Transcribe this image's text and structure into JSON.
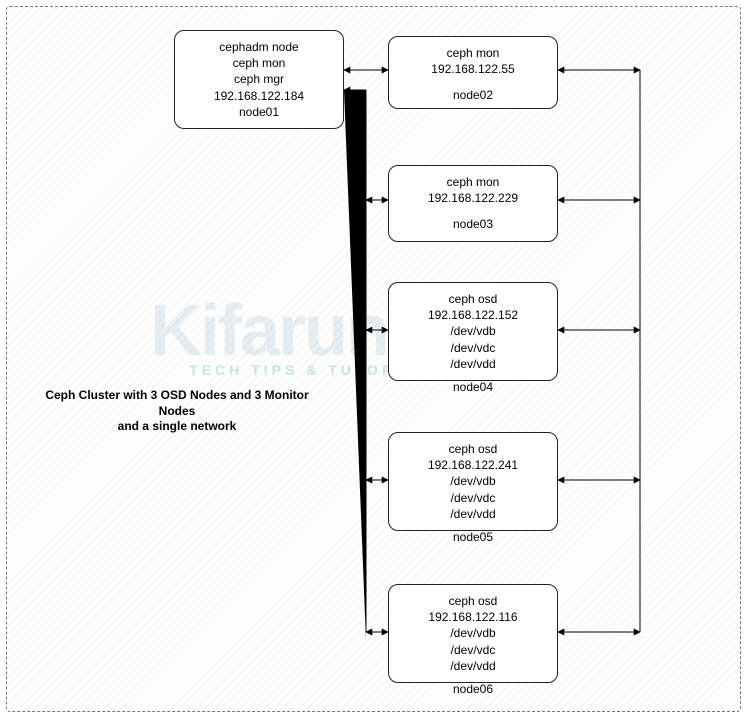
{
  "caption_line1": "Ceph Cluster with 3 OSD Nodes and 3 Monitor Nodes",
  "caption_line2": "and a single network",
  "watermark_main": "Kifarunix",
  "watermark_sub": "TECH TIPS & TUTORIALS",
  "nodes": {
    "node01": {
      "lines": [
        "cephadm node",
        "ceph mon",
        "ceph mgr",
        "192.168.122.184"
      ],
      "tag": "node01"
    },
    "node02": {
      "lines": [
        "ceph mon",
        "192.168.122.55"
      ],
      "tag": "node02"
    },
    "node03": {
      "lines": [
        "ceph mon",
        "192.168.122.229"
      ],
      "tag": "node03"
    },
    "node04": {
      "lines": [
        "ceph osd",
        "192.168.122.152",
        "/dev/vdb",
        "/dev/vdc",
        "/dev/vdd"
      ],
      "tag": "node04"
    },
    "node05": {
      "lines": [
        "ceph osd",
        "192.168.122.241",
        "/dev/vdb",
        "/dev/vdc",
        "/dev/vdd"
      ],
      "tag": "node05"
    },
    "node06": {
      "lines": [
        "ceph osd",
        "192.168.122.116",
        "/dev/vdb",
        "/dev/vdc",
        "/dev/vdd"
      ],
      "tag": "node06"
    }
  },
  "chart_data": {
    "type": "diagram",
    "title": "Ceph Cluster with 3 OSD Nodes and 3 Monitor Nodes and a single network",
    "nodes": [
      {
        "id": "node01",
        "roles": [
          "cephadm node",
          "ceph mon",
          "ceph mgr"
        ],
        "ip": "192.168.122.184"
      },
      {
        "id": "node02",
        "roles": [
          "ceph mon"
        ],
        "ip": "192.168.122.55"
      },
      {
        "id": "node03",
        "roles": [
          "ceph mon"
        ],
        "ip": "192.168.122.229"
      },
      {
        "id": "node04",
        "roles": [
          "ceph osd"
        ],
        "ip": "192.168.122.152",
        "devices": [
          "/dev/vdb",
          "/dev/vdc",
          "/dev/vdd"
        ]
      },
      {
        "id": "node05",
        "roles": [
          "ceph osd"
        ],
        "ip": "192.168.122.241",
        "devices": [
          "/dev/vdb",
          "/dev/vdc",
          "/dev/vdd"
        ]
      },
      {
        "id": "node06",
        "roles": [
          "ceph osd"
        ],
        "ip": "192.168.122.116",
        "devices": [
          "/dev/vdb",
          "/dev/vdc",
          "/dev/vdd"
        ]
      }
    ],
    "edges": [
      {
        "from": "node01",
        "to": "node02",
        "bidirectional": true
      },
      {
        "from": "node01",
        "to": "node03",
        "bidirectional": true
      },
      {
        "from": "node01",
        "to": "node04",
        "bidirectional": true
      },
      {
        "from": "node01",
        "to": "node05",
        "bidirectional": true
      },
      {
        "from": "node01",
        "to": "node06",
        "bidirectional": true
      },
      {
        "from": "node02",
        "to": "node03",
        "bidirectional": true,
        "via": "right-bus"
      },
      {
        "from": "node03",
        "to": "node04",
        "bidirectional": true,
        "via": "right-bus"
      },
      {
        "from": "node04",
        "to": "node05",
        "bidirectional": true,
        "via": "right-bus"
      },
      {
        "from": "node05",
        "to": "node06",
        "bidirectional": true,
        "via": "right-bus"
      }
    ]
  }
}
